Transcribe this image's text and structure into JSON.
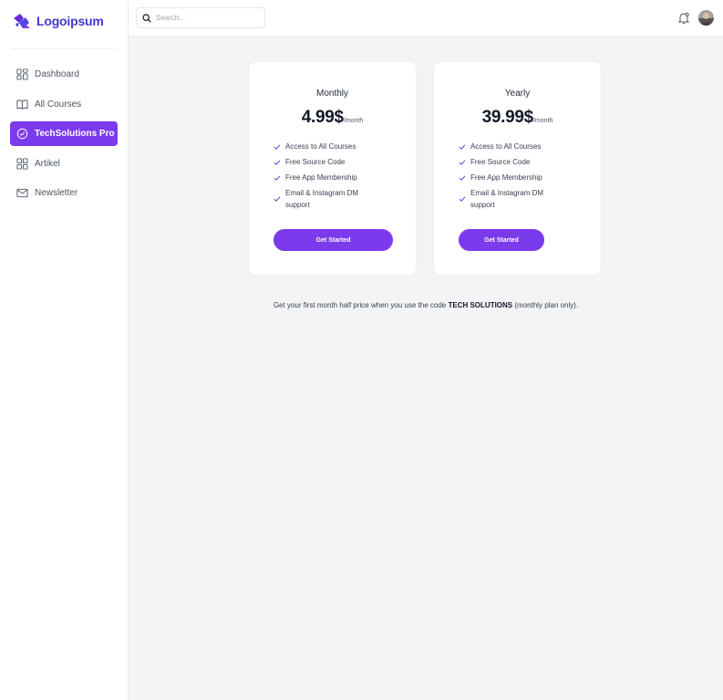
{
  "brand": {
    "name": "Logoipsum",
    "logo_icon": "logo-mark-icon",
    "color": "#4338ca"
  },
  "accent_color": "#7c3aed",
  "search": {
    "placeholder": "Search..."
  },
  "header": {
    "notification_icon": "bell-icon",
    "avatar_icon": "user-avatar"
  },
  "sidebar": {
    "items": [
      {
        "label": "Dashboard",
        "icon": "grid-icon",
        "active": false
      },
      {
        "label": "All Courses",
        "icon": "book-open-icon",
        "active": false
      },
      {
        "label": "TechSolutions Pro",
        "icon": "check-circle-icon",
        "active": true
      },
      {
        "label": "Artikel",
        "icon": "grid-icon",
        "active": false
      },
      {
        "label": "Newsletter",
        "icon": "mail-icon",
        "active": false
      }
    ]
  },
  "plans": [
    {
      "title": "Monthly",
      "price": "4.99$",
      "period": "/month",
      "features": [
        "Access to All Courses",
        "Free Source Code",
        "Free App Membership",
        "Email & Instagram DM support"
      ],
      "cta": "Get Started"
    },
    {
      "title": "Yearly",
      "price": "39.99$",
      "period": "/month",
      "features": [
        "Access to All Courses",
        "Free Source Code",
        "Free App Membership",
        "Email & Instagram DM support"
      ],
      "cta": "Get Started"
    }
  ],
  "promo": {
    "before": "Get your first month half price when you use the code ",
    "code": "TECH SOLUTIONS",
    "after": " (monthly plan only)."
  }
}
